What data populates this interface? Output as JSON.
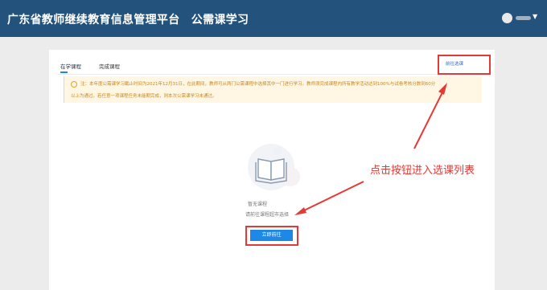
{
  "header": {
    "title": "广东省教师继续教育信息管理平台　公需课学习"
  },
  "tabs": [
    {
      "label": "在学课程",
      "active": true
    },
    {
      "label": "完成课程",
      "active": false
    }
  ],
  "select_button_label": "前往选课",
  "notice": {
    "line1": "注：本年度公需课学习截止时间为2021年12月31日，在此期间，教师可从两门公需课程中选择其中一门进行学习。教师须完成课程内所有教学活动达到100%与试卷考核分数到60分",
    "line2": "以上为通过。若任意一项课程任务未能期完成，则本次公需课学习未通过。"
  },
  "empty_state": {
    "title": "暂无课程",
    "hint": "请前往课程超市选择",
    "button_label": "立即前往"
  },
  "annotation": {
    "text": "点击按钮进入选课列表"
  },
  "colors": {
    "header_bg": "#23527c",
    "primary": "#1e88e5",
    "annotation_red": "#e53935",
    "notice_text": "#c7881f"
  }
}
